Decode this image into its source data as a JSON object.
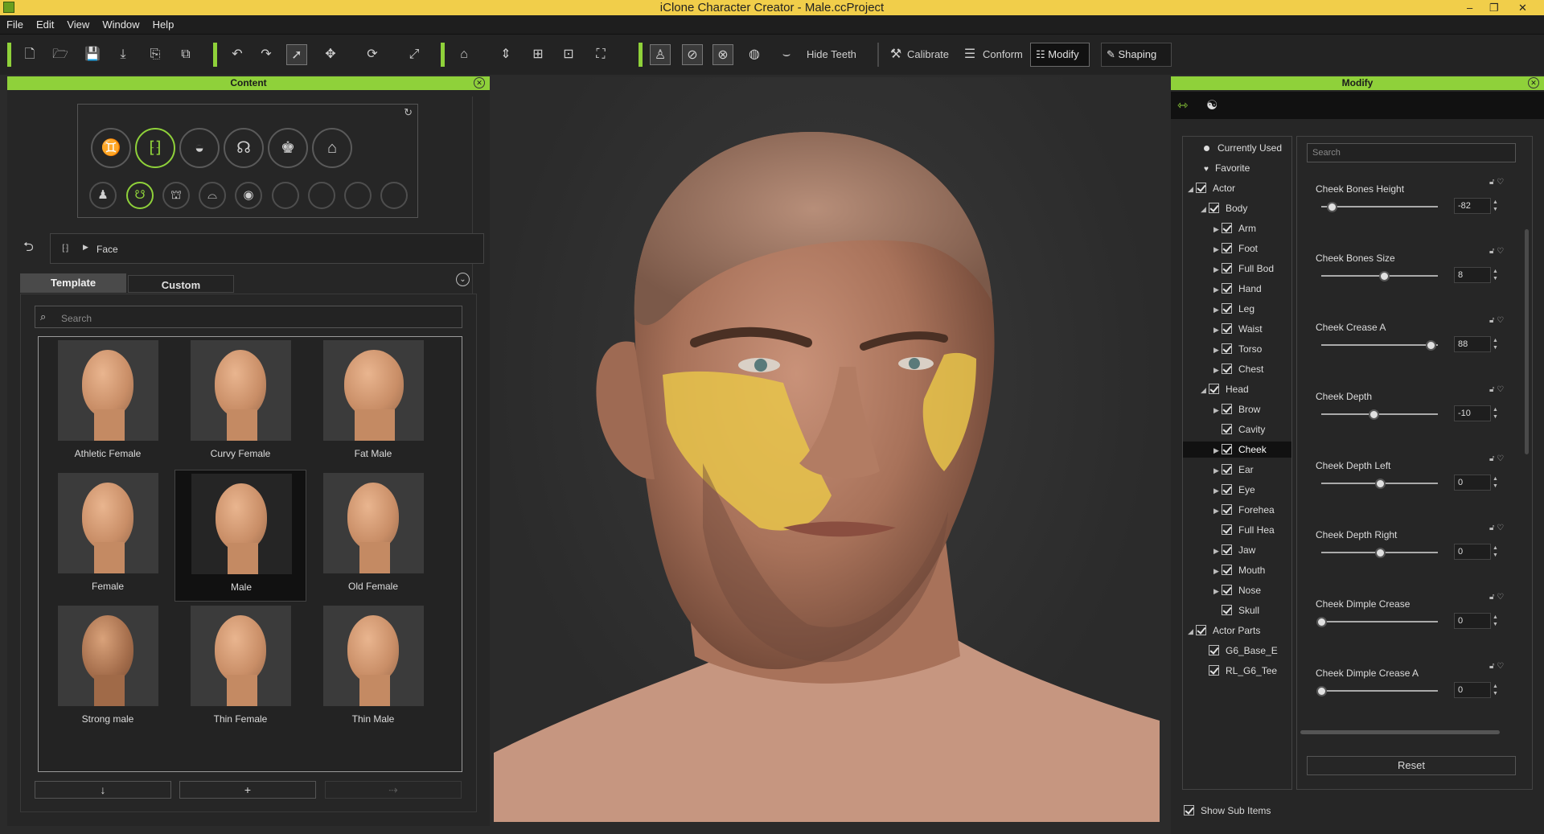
{
  "title": "iClone Character Creator - Male.ccProject",
  "menu": [
    "File",
    "Edit",
    "View",
    "Window",
    "Help"
  ],
  "toolbar": {
    "hide_teeth": "Hide Teeth",
    "calibrate": "Calibrate",
    "conform": "Conform",
    "modify": "Modify",
    "shaping": "Shaping"
  },
  "content_panel": {
    "title": "Content",
    "breadcrumb": "Face",
    "tabs": [
      "Template",
      "Custom"
    ],
    "search_placeholder": "Search",
    "templates": [
      {
        "label": "Athletic Female"
      },
      {
        "label": "Curvy Female"
      },
      {
        "label": "Fat Male"
      },
      {
        "label": "Female"
      },
      {
        "label": "Male"
      },
      {
        "label": "Old Female"
      },
      {
        "label": "Strong male"
      },
      {
        "label": "Thin Female"
      },
      {
        "label": "Thin Male"
      }
    ],
    "selected": "Male"
  },
  "modify_panel": {
    "title": "Modify",
    "search_placeholder": "Search",
    "tree": [
      {
        "label": "Currently Used"
      },
      {
        "label": "Favorite"
      },
      {
        "label": "Actor"
      },
      {
        "label": "Body"
      },
      {
        "label": "Arm"
      },
      {
        "label": "Foot"
      },
      {
        "label": "Full Bod"
      },
      {
        "label": "Hand"
      },
      {
        "label": "Leg"
      },
      {
        "label": "Waist"
      },
      {
        "label": "Torso"
      },
      {
        "label": "Chest"
      },
      {
        "label": "Head"
      },
      {
        "label": "Brow"
      },
      {
        "label": "Cavity"
      },
      {
        "label": "Cheek"
      },
      {
        "label": "Ear"
      },
      {
        "label": "Eye"
      },
      {
        "label": "Forehea"
      },
      {
        "label": "Full Hea"
      },
      {
        "label": "Jaw"
      },
      {
        "label": "Mouth"
      },
      {
        "label": "Nose"
      },
      {
        "label": "Skull"
      },
      {
        "label": "Actor Parts"
      },
      {
        "label": "G6_Base_E"
      },
      {
        "label": "RL_G6_Tee"
      }
    ],
    "sliders": [
      {
        "name": "Cheek Bones Height",
        "value": "-82",
        "level": 0.09
      },
      {
        "name": "Cheek Bones Size",
        "value": "8",
        "level": 0.54
      },
      {
        "name": "Cheek Crease A",
        "value": "88",
        "level": 0.94
      },
      {
        "name": "Cheek Depth",
        "value": "-10",
        "level": 0.45
      },
      {
        "name": "Cheek Depth Left",
        "value": "0",
        "level": 0.5
      },
      {
        "name": "Cheek Depth Right",
        "value": "0",
        "level": 0.5
      },
      {
        "name": "Cheek Dimple Crease",
        "value": "0",
        "level": 0.0
      },
      {
        "name": "Cheek Dimple Crease A",
        "value": "0",
        "level": 0.0
      }
    ],
    "reset": "Reset",
    "show_sub_items": "Show Sub Items"
  },
  "colors": {
    "accent": "#8fd13a",
    "title_bar": "#f1ce4a",
    "highlight": "#e8c44a"
  }
}
